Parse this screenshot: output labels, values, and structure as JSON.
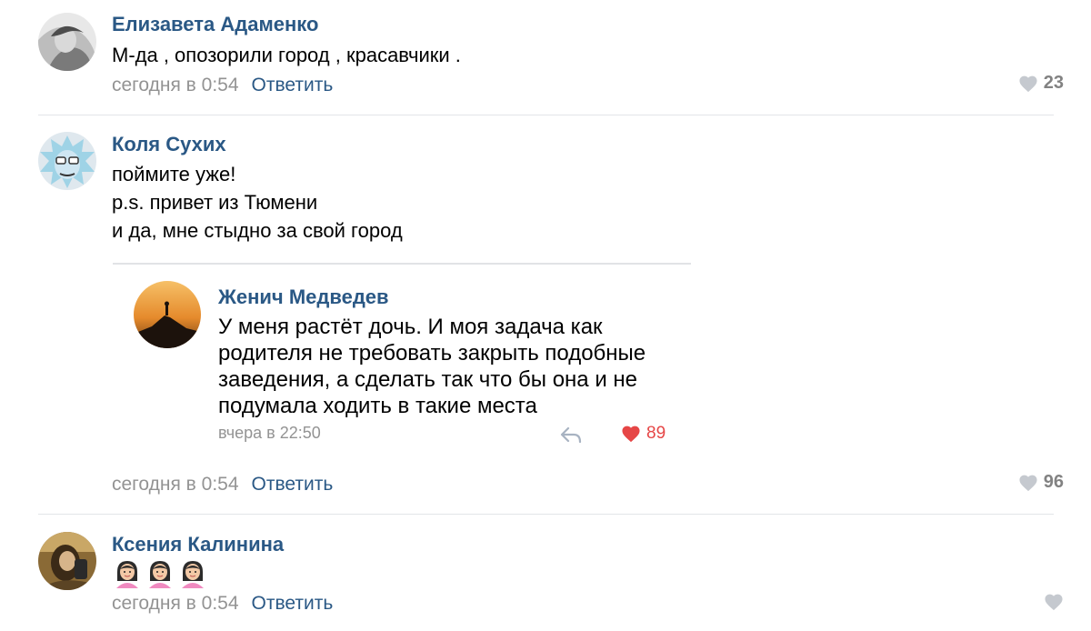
{
  "comments": [
    {
      "author": "Елизавета Адаменко",
      "text_lines": [
        "М-да , опозорили город , красавчики ."
      ],
      "time": "сегодня в 0:54",
      "reply_label": "Ответить",
      "likes": "23"
    },
    {
      "author": "Коля Сухих",
      "text_lines": [
        "поймите уже!",
        "p.s. привет из Тюмени",
        "и да, мне стыдно за свой город"
      ],
      "time": "сегодня в 0:54",
      "reply_label": "Ответить",
      "likes": "96",
      "quote": {
        "author": "Женич Медведев",
        "text": "У меня растёт дочь. И моя задача как родителя не требовать закрыть подобные заведения, а сделать так что бы она и не подумала ходить в такие места",
        "time": "вчера в 22:50",
        "likes": "89"
      }
    },
    {
      "author": "Ксения Калинина",
      "emoji_count": 3,
      "time": "сегодня в 0:54",
      "reply_label": "Ответить",
      "likes": ""
    }
  ],
  "icons": {
    "like": "heart-icon",
    "share": "reply-arrow-icon",
    "emoji": "woman-emoji"
  },
  "colors": {
    "link": "#2a5885",
    "meta": "#939393",
    "like_active": "#e64646",
    "like_inactive": "#c5c9cf"
  }
}
